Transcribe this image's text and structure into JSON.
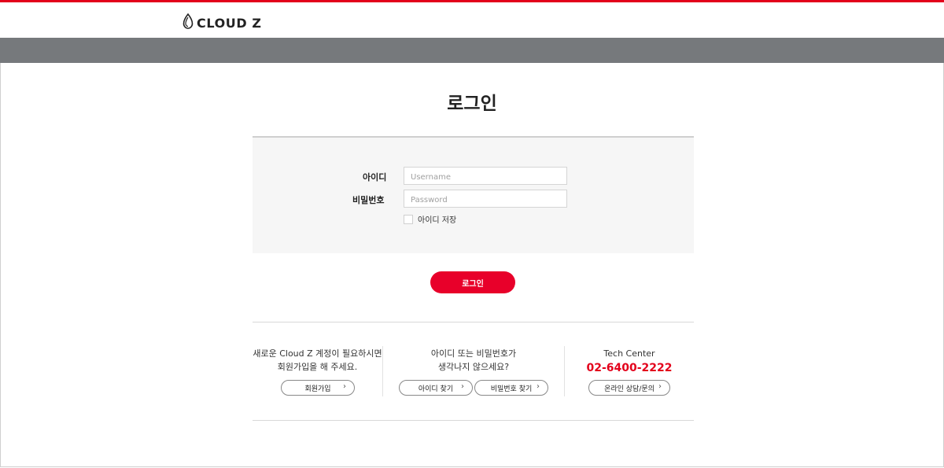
{
  "brand": {
    "logo_text": "CLOUD Z"
  },
  "page": {
    "title": "로그인"
  },
  "form": {
    "id_label": "아이디",
    "id_placeholder": "Username",
    "password_label": "비밀번호",
    "password_placeholder": "Password",
    "remember_label": "아이디 저장",
    "login_button": "로그인"
  },
  "footer": {
    "signup": {
      "line1": "새로운 Cloud Z 계정이 필요하시면",
      "line2": "회원가입을 해 주세요.",
      "button": "회원가입"
    },
    "find": {
      "line1": "아이디 또는 비밀번호가",
      "line2": "생각나지 않으세요?",
      "find_id_button": "아이디 찾기",
      "find_password_button": "비밀번호 찾기"
    },
    "tech": {
      "title": "Tech Center",
      "phone": "02-6400-2222",
      "button": "온라인 상담/문의"
    }
  },
  "colors": {
    "accent": "#e8002a",
    "greybar": "#76797c"
  }
}
